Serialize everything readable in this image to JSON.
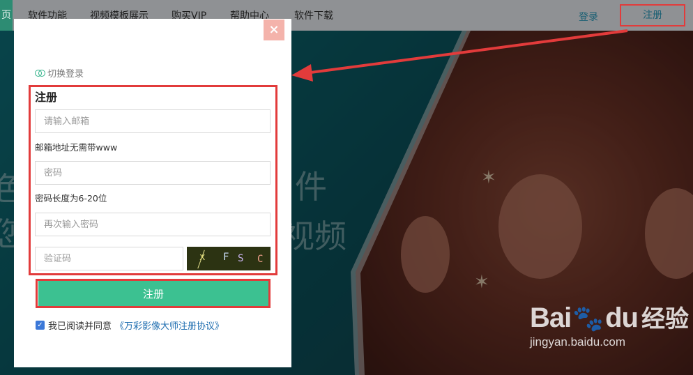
{
  "nav": {
    "home_fragment": "页",
    "items": [
      "软件功能",
      "视频模板展示",
      "购买VIP",
      "帮助中心",
      "软件下载"
    ],
    "login": "登录",
    "register": "注册"
  },
  "background": {
    "big_text": [
      "色",
      "件",
      "您",
      "视频"
    ]
  },
  "dialog": {
    "close_glyph": "×",
    "switch_login": "切换登录",
    "title": "注册",
    "email_placeholder": "请输入邮箱",
    "email_hint": "邮箱地址无需带www",
    "password_placeholder": "密码",
    "password_hint": "密码长度为6-20位",
    "confirm_placeholder": "再次输入密码",
    "captcha_placeholder": "验证码",
    "captcha_chars": [
      "x",
      "F",
      "S",
      "C"
    ],
    "submit": "注册",
    "agree_text": "我已阅读并同意",
    "agree_link": "《万彩影像大师注册协议》"
  },
  "watermark": {
    "logo_left": "Bai",
    "logo_right": "du",
    "brand_cn": "经验",
    "url": "jingyan.baidu.com"
  },
  "colors": {
    "accent_green": "#3cc191",
    "annotation_red": "#e23b3b",
    "link_blue": "#1f6eb0"
  }
}
